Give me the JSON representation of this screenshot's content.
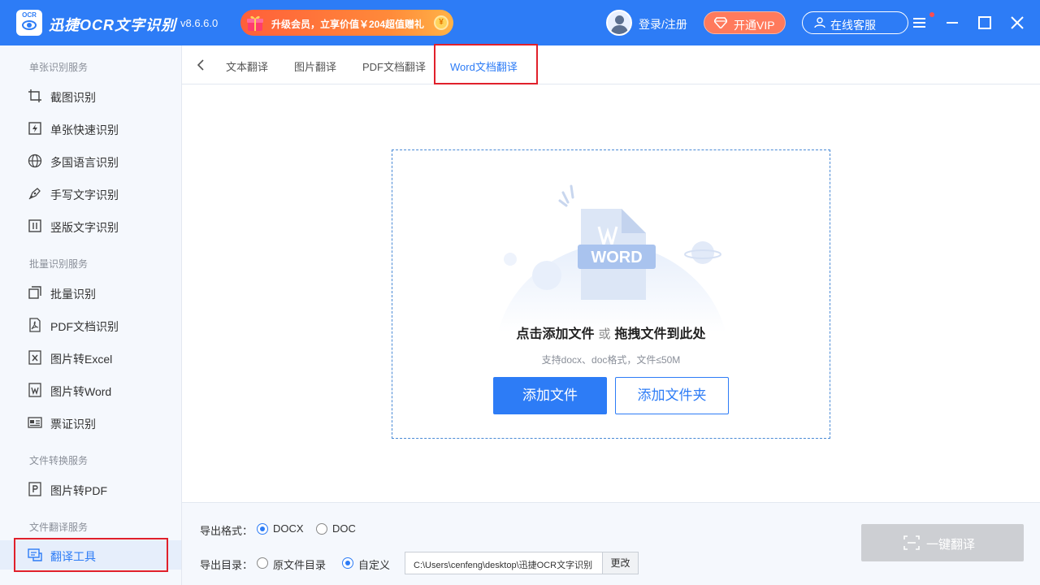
{
  "app": {
    "logo_text": "OCR",
    "name": "迅捷OCR文字识别",
    "version": "v8.6.6.0"
  },
  "header": {
    "promo_text": "升级会员，立享价值￥204超值赠礼",
    "login_label": "登录/注册",
    "vip_label": "开通VIP",
    "service_label": "在线客服"
  },
  "sidebar": {
    "sections": [
      {
        "title": "单张识别服务",
        "items": [
          {
            "label": "截图识别",
            "icon": "crop-icon"
          },
          {
            "label": "单张快速识别",
            "icon": "image-fast-icon"
          },
          {
            "label": "多国语言识别",
            "icon": "globe-icon"
          },
          {
            "label": "手写文字识别",
            "icon": "pen-icon"
          },
          {
            "label": "竖版文字识别",
            "icon": "vertical-text-icon"
          }
        ]
      },
      {
        "title": "批量识别服务",
        "items": [
          {
            "label": "批量识别",
            "icon": "stack-icon"
          },
          {
            "label": "PDF文档识别",
            "icon": "pdf-icon"
          },
          {
            "label": "图片转Excel",
            "icon": "excel-icon"
          },
          {
            "label": "图片转Word",
            "icon": "word-icon"
          },
          {
            "label": "票证识别",
            "icon": "id-card-icon"
          }
        ]
      },
      {
        "title": "文件转换服务",
        "items": [
          {
            "label": "图片转PDF",
            "icon": "p-file-icon"
          }
        ]
      },
      {
        "title": "文件翻译服务",
        "items": [
          {
            "label": "翻译工具",
            "icon": "translate-icon",
            "active": true
          }
        ]
      }
    ]
  },
  "tabs": [
    {
      "label": "文本翻译"
    },
    {
      "label": "图片翻译"
    },
    {
      "label": "PDF文档翻译"
    },
    {
      "label": "Word文档翻译",
      "active": true
    }
  ],
  "dropzone": {
    "badge_text": "WORD",
    "title_part1": "点击添加文件",
    "title_or": "或",
    "title_part2": "拖拽文件到此处",
    "subtitle": "支持docx、doc格式，文件≤50M",
    "add_file_label": "添加文件",
    "add_folder_label": "添加文件夹"
  },
  "bottom": {
    "format_label": "导出格式：",
    "format_options": [
      {
        "label": "DOCX",
        "selected": true
      },
      {
        "label": "DOC",
        "selected": false
      }
    ],
    "dir_label": "导出目录：",
    "dir_options": [
      {
        "label": "原文件目录",
        "selected": false
      },
      {
        "label": "自定义",
        "selected": true
      }
    ],
    "path_value": "C:\\Users\\cenfeng\\desktop\\迅捷OCR文字识别",
    "change_label": "更改",
    "translate_label": "一键翻译"
  },
  "colors": {
    "brand": "#2d7cf6",
    "promo": "#ff6a3c",
    "vip": "#ff7a5c",
    "disabled": "#cdcfd3"
  }
}
